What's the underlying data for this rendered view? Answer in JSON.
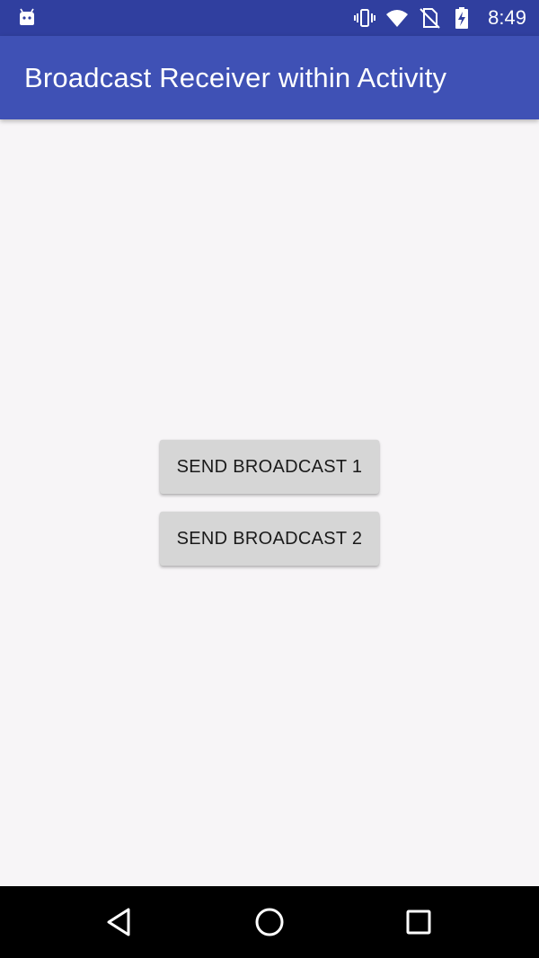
{
  "status_bar": {
    "time": "8:49",
    "icons": [
      "android-debug-icon",
      "vibrate-icon",
      "wifi-icon",
      "no-sim-icon",
      "battery-charging-icon"
    ],
    "background": "#303f9f"
  },
  "app_bar": {
    "title": "Broadcast Receiver within Activity",
    "background": "#3f51b5"
  },
  "main": {
    "buttons": [
      {
        "label": "SEND BROADCAST 1"
      },
      {
        "label": "SEND BROADCAST 2"
      }
    ],
    "background": "#f7f5f7"
  },
  "nav_bar": {
    "icons": [
      "back-icon",
      "home-icon",
      "recents-icon"
    ],
    "background": "#000000"
  }
}
